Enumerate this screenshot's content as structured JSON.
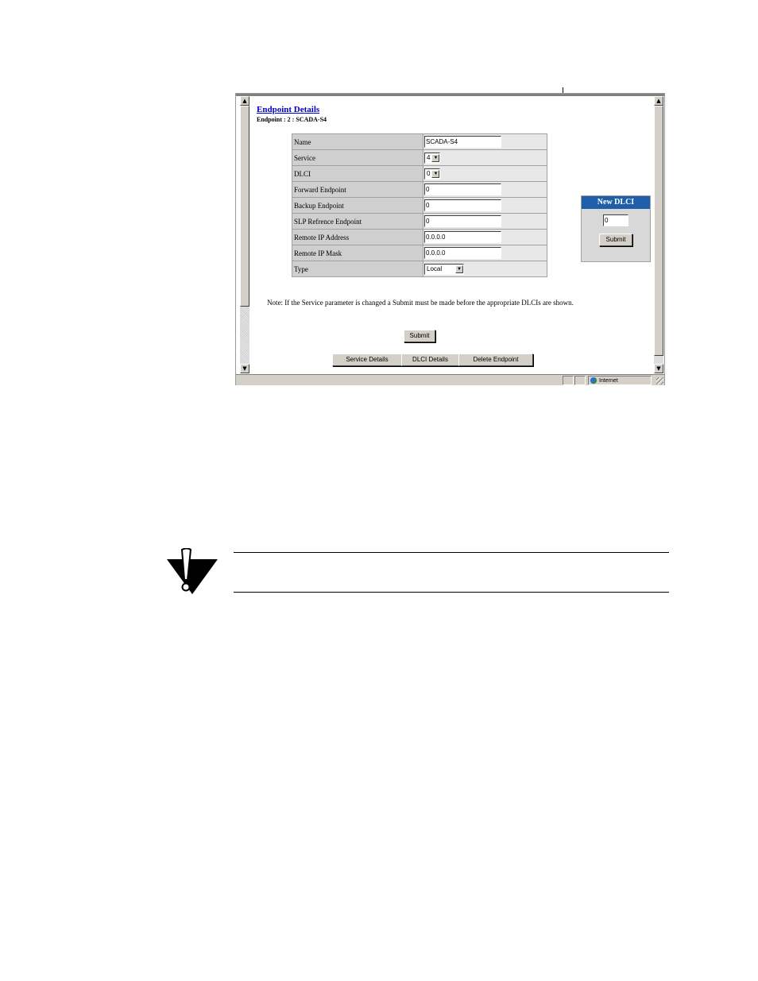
{
  "page": {
    "title": "Endpoint Details",
    "subtitle": "Endpoint : 2 : SCADA-S4"
  },
  "form": {
    "rows": [
      {
        "label": "Name",
        "kind": "text",
        "value": "SCADA-S4"
      },
      {
        "label": "Service",
        "kind": "select",
        "value": "4"
      },
      {
        "label": "DLCI",
        "kind": "select",
        "value": "0"
      },
      {
        "label": "Forward Endpoint",
        "kind": "text",
        "value": "0"
      },
      {
        "label": "Backup Endpoint",
        "kind": "text",
        "value": "0"
      },
      {
        "label": "SLP Refrence Endpoint",
        "kind": "text",
        "value": "0"
      },
      {
        "label": "Remote IP Address",
        "kind": "text",
        "value": "0.0.0.0"
      },
      {
        "label": "Remote IP Mask",
        "kind": "text",
        "value": "0.0.0.0"
      },
      {
        "label": "Type",
        "kind": "select",
        "value": "Local"
      }
    ]
  },
  "new_dlci": {
    "title": "New DLCI",
    "value": "0",
    "submit_label": "Submit"
  },
  "note": "Note:  If the Service parameter is changed a Submit must be made before the appropriate DLCIs are shown.",
  "submit_label": "Submit",
  "buttons": {
    "service_details": "Service Details",
    "dlci_details": "DLCI Details",
    "delete_endpoint": "Delete Endpoint"
  },
  "statusbar": {
    "zone": "Internet"
  },
  "colors": {
    "title_link": "#0000cc",
    "panel_header": "#1f5fa8"
  }
}
